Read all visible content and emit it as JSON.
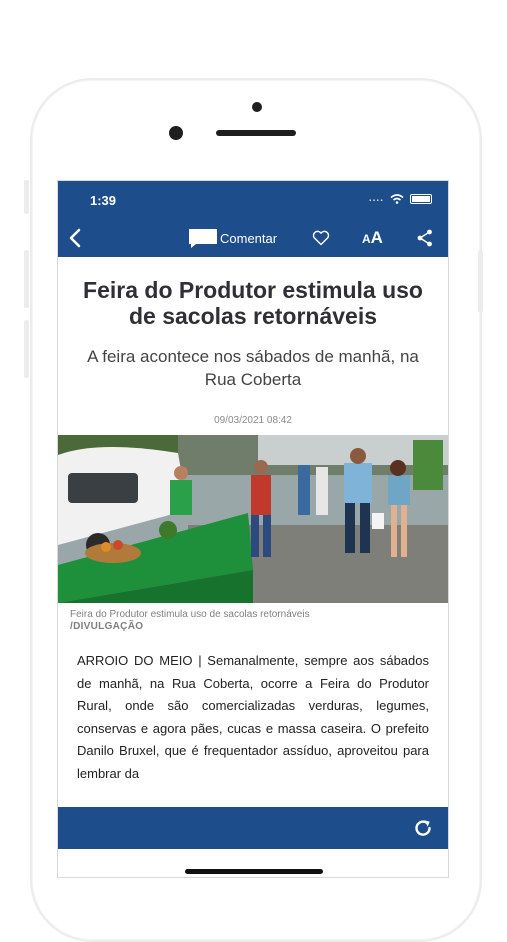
{
  "status_bar": {
    "time": "1:39",
    "signal": "...."
  },
  "nav": {
    "back_icon": "chevron-left-icon",
    "comment_label": "Comentar",
    "heart_icon": "heart-icon",
    "font_size_label_small": "A",
    "font_size_label_large": "A",
    "share_icon": "share-icon"
  },
  "article": {
    "title": "Feira do Produtor estimula uso de sacolas retornáveis",
    "subtitle": "A feira acontece nos sábados de manhã, na Rua Coberta",
    "date": "09/03/2021 08:42",
    "photo_caption": "Feira do Produtor estimula uso de sacolas retornáveis",
    "photo_credit": "/DIVULGAÇÃO",
    "body": "ARROIO DO MEIO | Semanalmente, sempre aos sábados de manhã, na Rua Coberta, ocorre a Feira do Produtor Rural, onde são comercializadas verduras, legumes, conservas e agora pães, cucas e massa caseira. O prefeito Danilo Bruxel, que é frequentador assíduo, aproveitou para lembrar da"
  },
  "bottom_bar": {
    "refresh_icon": "refresh-icon"
  },
  "colors": {
    "brand": "#1e4d8c",
    "text": "#2f3036",
    "muted": "#8a8a8a"
  }
}
